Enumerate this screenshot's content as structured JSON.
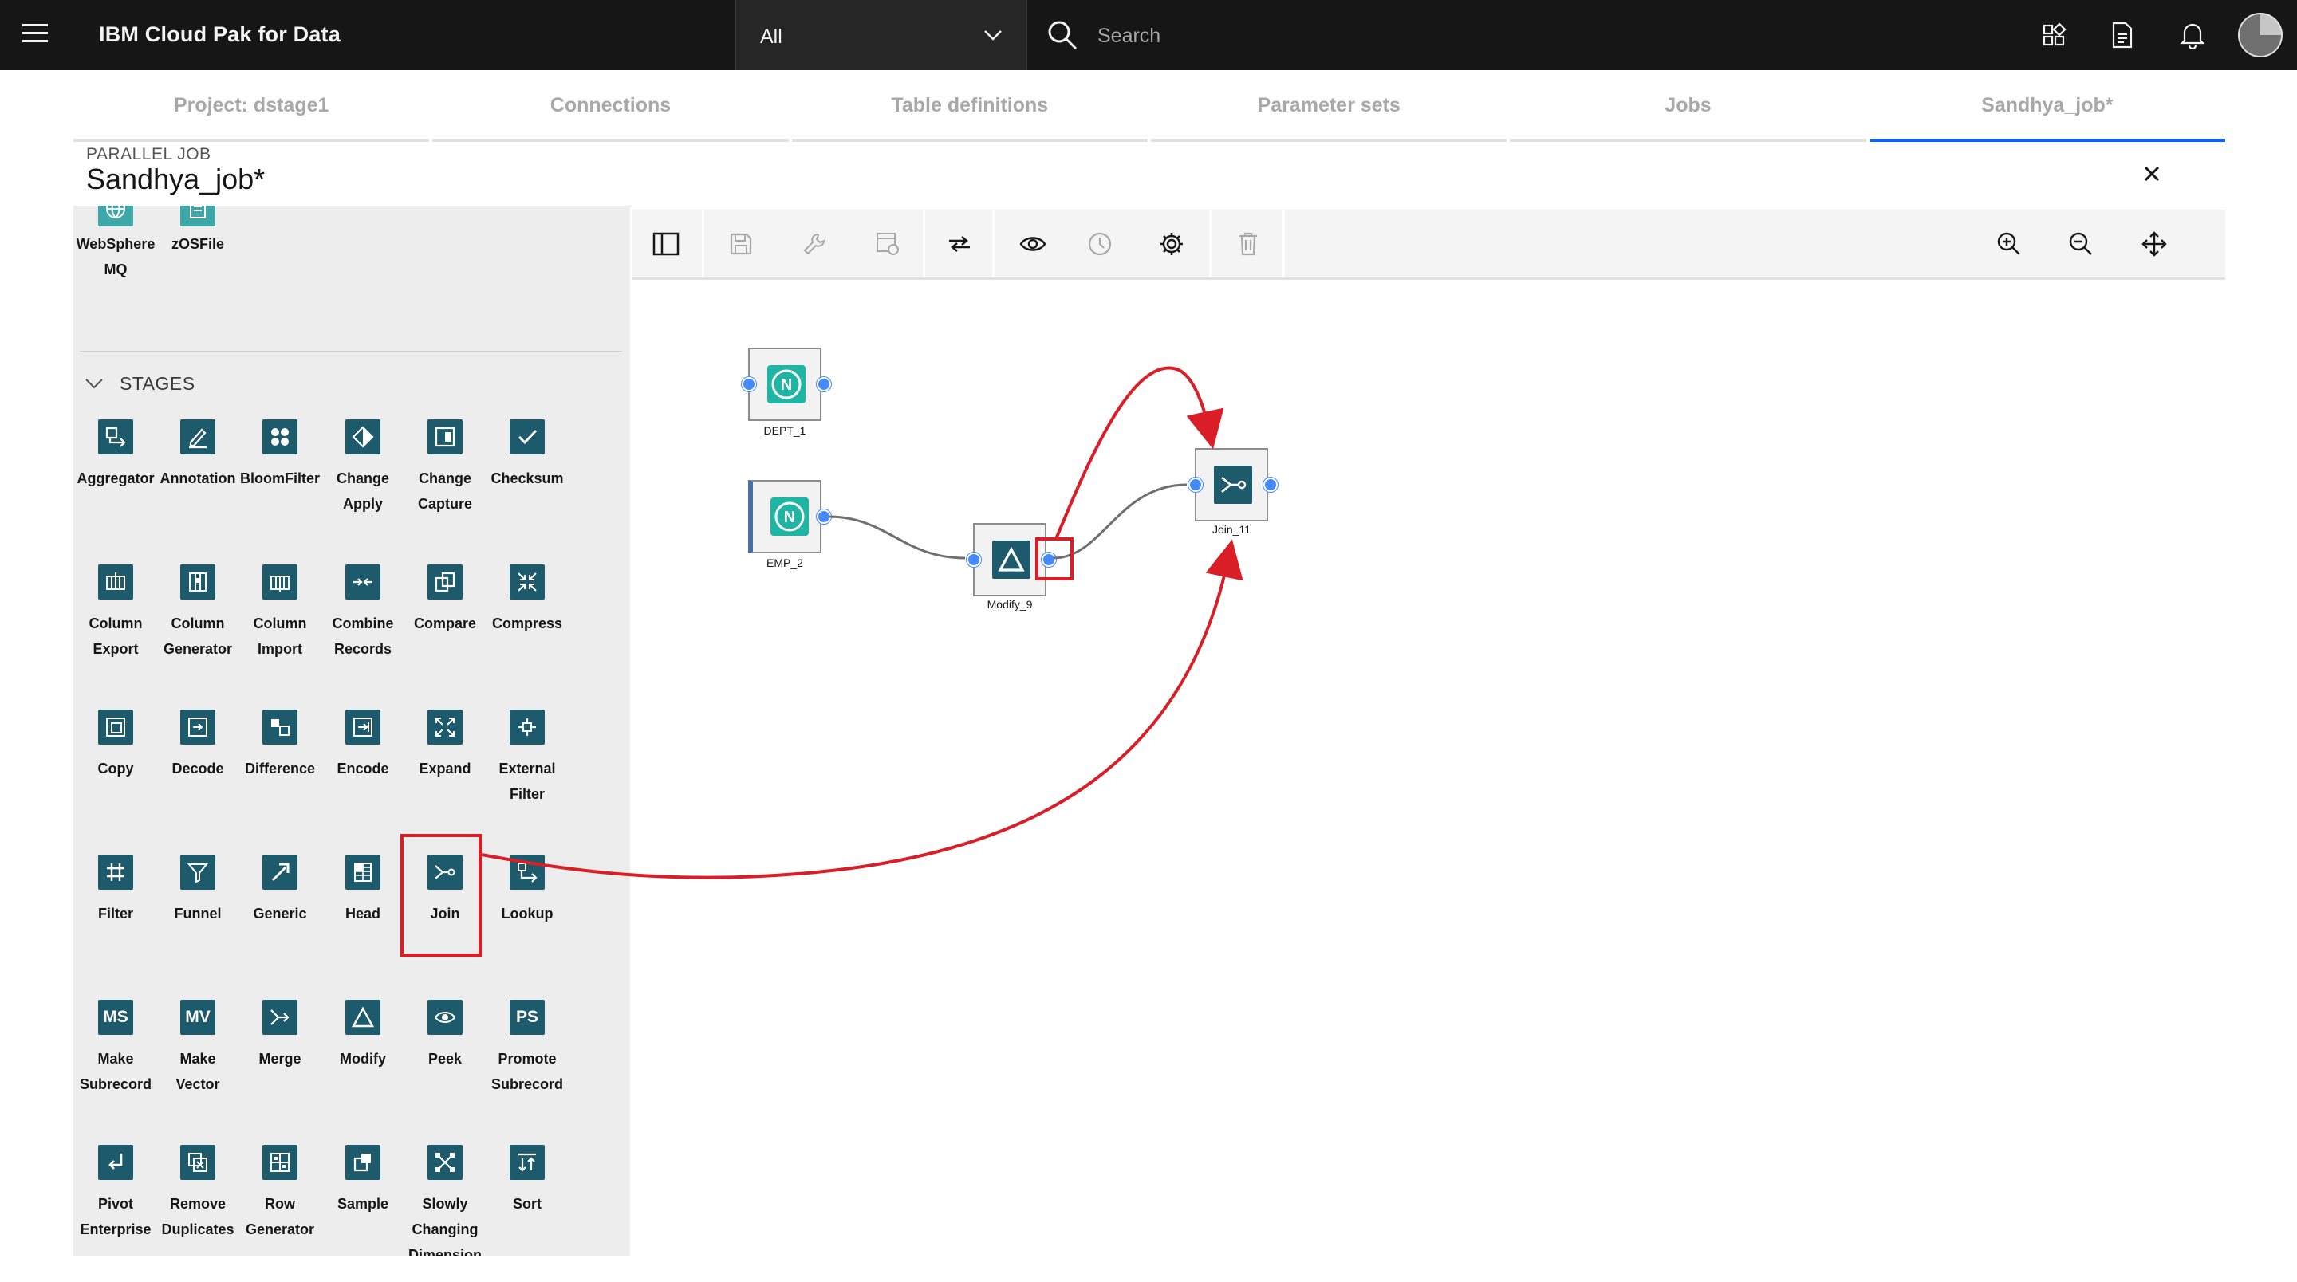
{
  "header": {
    "brand": "IBM Cloud Pak for Data",
    "scope_value": "All",
    "search_placeholder": "Search",
    "icons": [
      "hamburger-icon",
      "chevron-down-icon",
      "search-icon",
      "app-switcher-icon",
      "document-icon",
      "notification-icon",
      "avatar"
    ]
  },
  "tabs": [
    {
      "label": "Project: dstage1",
      "active": false
    },
    {
      "label": "Connections",
      "active": false
    },
    {
      "label": "Table definitions",
      "active": false
    },
    {
      "label": "Parameter sets",
      "active": false
    },
    {
      "label": "Jobs",
      "active": false
    },
    {
      "label": "Sandhya_job*",
      "active": true
    }
  ],
  "job": {
    "kind": "PARALLEL JOB",
    "name": "Sandhya_job*"
  },
  "palette": {
    "connectors_tail": [
      {
        "line1": "WebSphere",
        "line2": "MQ"
      },
      {
        "line1": "zOSFile",
        "line2": ""
      }
    ],
    "section_label": "STAGES",
    "stages": [
      {
        "line1": "Aggregator",
        "line2": ""
      },
      {
        "line1": "Annotation",
        "line2": ""
      },
      {
        "line1": "BloomFilter",
        "line2": ""
      },
      {
        "line1": "Change",
        "line2": "Apply"
      },
      {
        "line1": "Change",
        "line2": "Capture"
      },
      {
        "line1": "Checksum",
        "line2": ""
      },
      {
        "line1": "Column",
        "line2": "Export"
      },
      {
        "line1": "Column",
        "line2": "Generator"
      },
      {
        "line1": "Column",
        "line2": "Import"
      },
      {
        "line1": "Combine",
        "line2": "Records"
      },
      {
        "line1": "Compare",
        "line2": ""
      },
      {
        "line1": "Compress",
        "line2": ""
      },
      {
        "line1": "Copy",
        "line2": ""
      },
      {
        "line1": "Decode",
        "line2": ""
      },
      {
        "line1": "Difference",
        "line2": ""
      },
      {
        "line1": "Encode",
        "line2": ""
      },
      {
        "line1": "Expand",
        "line2": ""
      },
      {
        "line1": "External",
        "line2": "Filter"
      },
      {
        "line1": "Filter",
        "line2": ""
      },
      {
        "line1": "Funnel",
        "line2": ""
      },
      {
        "line1": "Generic",
        "line2": ""
      },
      {
        "line1": "Head",
        "line2": ""
      },
      {
        "line1": "Join",
        "line2": ""
      },
      {
        "line1": "Lookup",
        "line2": ""
      },
      {
        "line1": "Make",
        "line2": "Subrecord"
      },
      {
        "line1": "Make",
        "line2": "Vector"
      },
      {
        "line1": "Merge",
        "line2": ""
      },
      {
        "line1": "Modify",
        "line2": ""
      },
      {
        "line1": "Peek",
        "line2": ""
      },
      {
        "line1": "Promote",
        "line2": "Subrecord"
      },
      {
        "line1": "Pivot",
        "line2": "Enterprise"
      },
      {
        "line1": "Remove",
        "line2": "Duplicates"
      },
      {
        "line1": "Row",
        "line2": "Generator"
      },
      {
        "line1": "Sample",
        "line2": ""
      },
      {
        "line1": "Slowly",
        "line2": "Changing",
        "line3": "Dimension"
      },
      {
        "line1": "Sort",
        "line2": ""
      }
    ],
    "icon_text": {
      "ms": "MS",
      "mv": "MV",
      "ps": "PS"
    }
  },
  "toolbar": {
    "icons": [
      "toggle-palette-icon",
      "save-icon",
      "wrench-icon",
      "run-settings-icon",
      "arrange-icon",
      "view-icon",
      "history-icon",
      "settings-icon",
      "delete-icon",
      "zoom-in-icon",
      "zoom-out-icon",
      "fit-icon"
    ]
  },
  "canvas": {
    "nodes": [
      {
        "id": "DEPT_1",
        "label": "DEPT_1",
        "type": "netezza"
      },
      {
        "id": "EMP_2",
        "label": "EMP_2",
        "type": "netezza"
      },
      {
        "id": "Modify_9",
        "label": "Modify_9",
        "type": "modify"
      },
      {
        "id": "Join_11",
        "label": "Join_11",
        "type": "join"
      }
    ],
    "node_icon_letter": "N",
    "links": [
      {
        "from": "EMP_2",
        "to": "Modify_9"
      },
      {
        "from": "Modify_9",
        "to": "Join_11"
      }
    ],
    "annotation_color": "#da1e28",
    "accent": "#0f62fe",
    "stage_icon_color": "#1d5a6c",
    "connector_color": "#1fb5a5"
  }
}
